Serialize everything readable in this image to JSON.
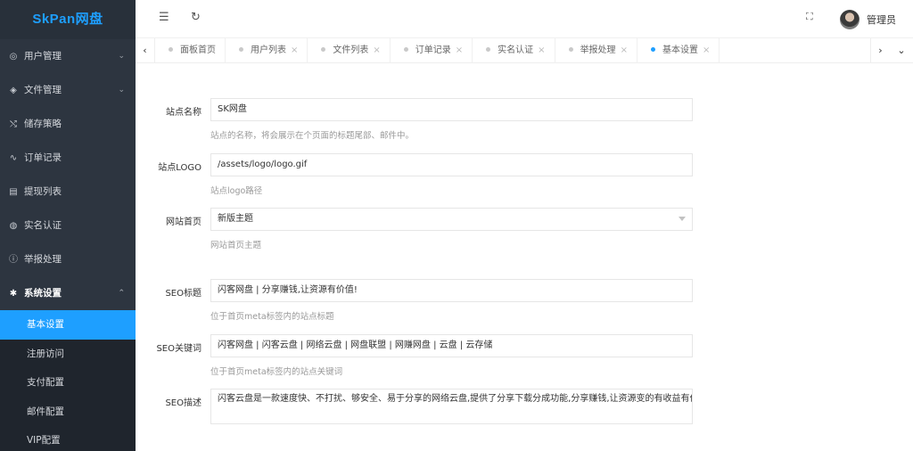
{
  "app": {
    "brand": "SkPan网盘"
  },
  "sidebar": {
    "items": [
      {
        "label": "用户管理",
        "icon": "◎",
        "arrow": "⌄"
      },
      {
        "label": "文件管理",
        "icon": "◈",
        "arrow": "⌄"
      },
      {
        "label": "储存策略",
        "icon": "⤭",
        "arrow": ""
      },
      {
        "label": "订单记录",
        "icon": "∿",
        "arrow": ""
      },
      {
        "label": "提现列表",
        "icon": "▤",
        "arrow": ""
      },
      {
        "label": "实名认证",
        "icon": "◍",
        "arrow": ""
      },
      {
        "label": "举报处理",
        "icon": "ⓘ",
        "arrow": ""
      },
      {
        "label": "系统设置",
        "icon": "✱",
        "arrow": "⌃"
      }
    ],
    "submenu": [
      {
        "label": "基本设置",
        "active": true
      },
      {
        "label": "注册访问",
        "active": false
      },
      {
        "label": "支付配置",
        "active": false
      },
      {
        "label": "邮件配置",
        "active": false
      },
      {
        "label": "VIP配置",
        "active": false
      }
    ]
  },
  "header": {
    "menu_toggle": "☰",
    "refresh": "↻",
    "fullscreen": "⛶",
    "admin_name": "管理员"
  },
  "tabs": {
    "prev": "‹",
    "next": "›",
    "dropdown": "⌄",
    "close": "×",
    "items": [
      {
        "label": "面板首页",
        "closable": false,
        "active": false
      },
      {
        "label": "用户列表",
        "closable": true,
        "active": false
      },
      {
        "label": "文件列表",
        "closable": true,
        "active": false
      },
      {
        "label": "订单记录",
        "closable": true,
        "active": false
      },
      {
        "label": "实名认证",
        "closable": true,
        "active": false
      },
      {
        "label": "举报处理",
        "closable": true,
        "active": false
      },
      {
        "label": "基本设置",
        "closable": true,
        "active": true
      }
    ]
  },
  "form": {
    "site_name": {
      "label": "站点名称",
      "value": "SK网盘",
      "help": "站点的名称，将会展示在个页面的标题尾部、邮件中。"
    },
    "site_logo": {
      "label": "站点LOGO",
      "value": "/assets/logo/logo.gif",
      "help": "站点logo路径"
    },
    "homepage": {
      "label": "网站首页",
      "value": "新版主题",
      "help": "网站首页主题"
    },
    "seo_title": {
      "label": "SEO标题",
      "value": "闪客网盘 | 分享赚钱,让资源有价值!",
      "help": "位于首页meta标签内的站点标题"
    },
    "seo_keywords": {
      "label": "SEO关键词",
      "value": "闪客网盘 | 闪客云盘 | 网络云盘 | 网盘联盟 | 网赚网盘 | 云盘 | 云存储",
      "help": "位于首页meta标签内的站点关键词"
    },
    "seo_description": {
      "label": "SEO描述",
      "value": "闪客云盘是一款速度快、不打扰、够安全、易于分享的网络云盘,提供了分享下载分成功能,分享赚钱,让资源变的有收益有价值!"
    }
  },
  "colors": {
    "accent": "#1e9fff",
    "sidebar_bg": "#2d3540",
    "submenu_bg": "#1f252d"
  }
}
